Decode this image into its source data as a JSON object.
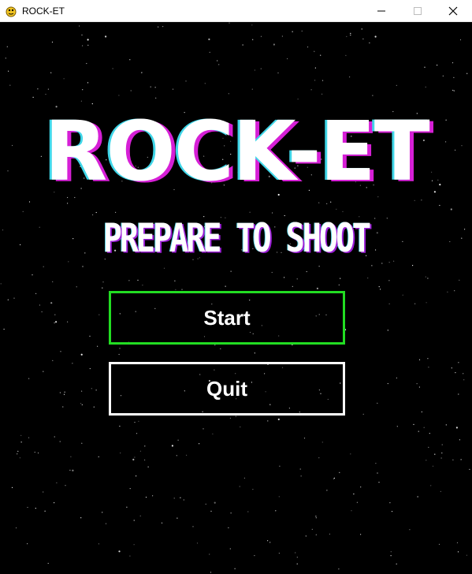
{
  "window": {
    "title": "ROCK-ET"
  },
  "game": {
    "logo": "ROCK-ET",
    "subtitle": "PREPARE TO SHOOT",
    "menu": {
      "start_label": "Start",
      "quit_label": "Quit"
    }
  },
  "colors": {
    "background": "#000000",
    "start_border": "#22dd22",
    "quit_border": "#ffffff",
    "glitch_magenta": "#d61fd6",
    "glitch_cyan": "#3fd6e8"
  },
  "icons": {
    "app_icon": "python-snake-icon",
    "minimize": "minimize-icon",
    "maximize": "maximize-icon",
    "close": "close-icon"
  }
}
